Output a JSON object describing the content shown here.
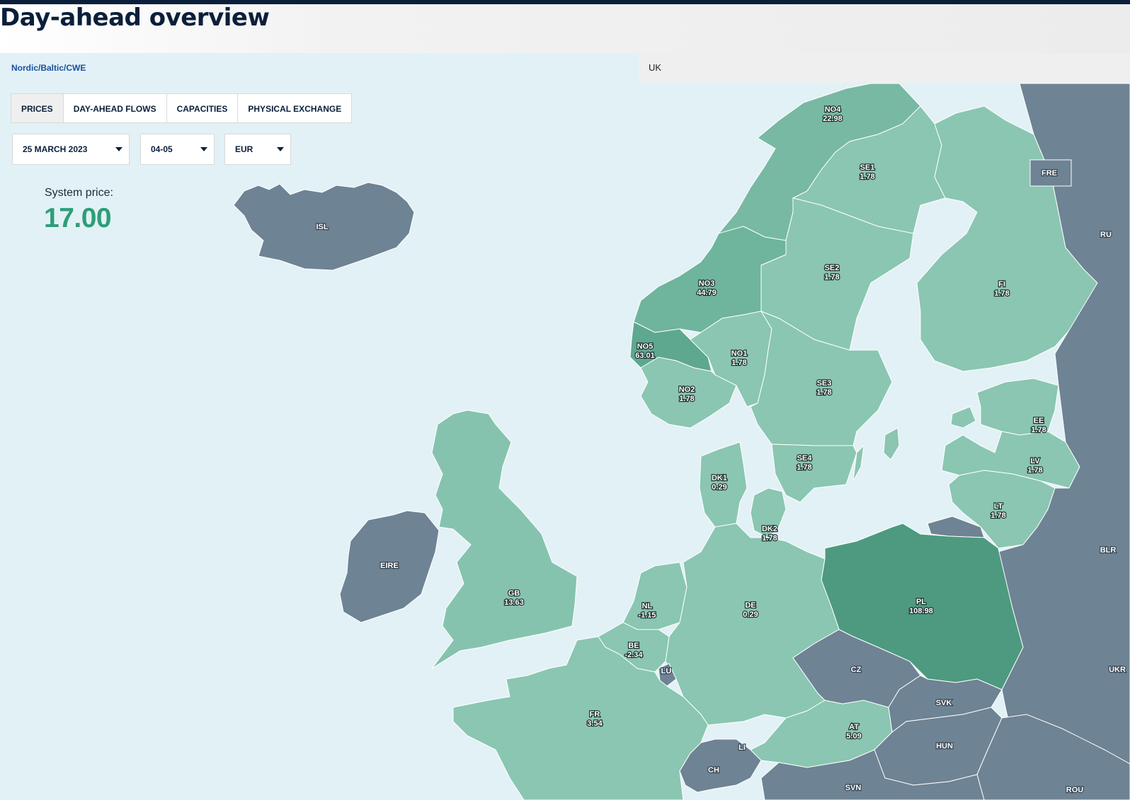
{
  "page": {
    "title": "Day-ahead overview"
  },
  "area_tabs": {
    "nordic": "Nordic/Baltic/CWE",
    "uk": "UK"
  },
  "tabs": [
    {
      "label": "PRICES",
      "active": true
    },
    {
      "label": "DAY-AHEAD FLOWS",
      "active": false
    },
    {
      "label": "CAPACITIES",
      "active": false
    },
    {
      "label": "PHYSICAL EXCHANGE",
      "active": false
    }
  ],
  "filters": {
    "date": "25 MARCH 2023",
    "hour": "04-05",
    "currency": "EUR"
  },
  "system_price": {
    "label": "System price:",
    "value": "17.00"
  },
  "colors": {
    "water": "#e2f1f6",
    "price_low": "#8ac6b1",
    "price_mid": "#6fb49d",
    "price_high": "#4d9a80",
    "non_member": "#6e8394",
    "accent_value": "#2e9e78"
  },
  "zones": [
    {
      "code": "NO4",
      "price": "22.98"
    },
    {
      "code": "SE1",
      "price": "1.78"
    },
    {
      "code": "SE2",
      "price": "1.78"
    },
    {
      "code": "FI",
      "price": "1.78"
    },
    {
      "code": "NO3",
      "price": "44.79"
    },
    {
      "code": "NO5",
      "price": "63.01"
    },
    {
      "code": "NO1",
      "price": "1.78"
    },
    {
      "code": "SE3",
      "price": "1.78"
    },
    {
      "code": "NO2",
      "price": "1.78"
    },
    {
      "code": "EE",
      "price": "1.78"
    },
    {
      "code": "SE4",
      "price": "1.78"
    },
    {
      "code": "LV",
      "price": "1.78"
    },
    {
      "code": "DK1",
      "price": "0.29"
    },
    {
      "code": "LT",
      "price": "1.78"
    },
    {
      "code": "DK2",
      "price": "1.78"
    },
    {
      "code": "PL",
      "price": "108.98"
    },
    {
      "code": "GB",
      "price": "13.63"
    },
    {
      "code": "NL",
      "price": "-1.15"
    },
    {
      "code": "DE",
      "price": "0.29"
    },
    {
      "code": "BE",
      "price": "-2.34"
    },
    {
      "code": "FR",
      "price": "3.54"
    },
    {
      "code": "AT",
      "price": "5.09"
    }
  ],
  "other_areas": [
    "ISL",
    "EIRE",
    "FRE",
    "RU",
    "BLR",
    "UKR",
    "CZ",
    "SVK",
    "HUN",
    "ROU",
    "CH",
    "LI",
    "LU",
    "SVN"
  ]
}
